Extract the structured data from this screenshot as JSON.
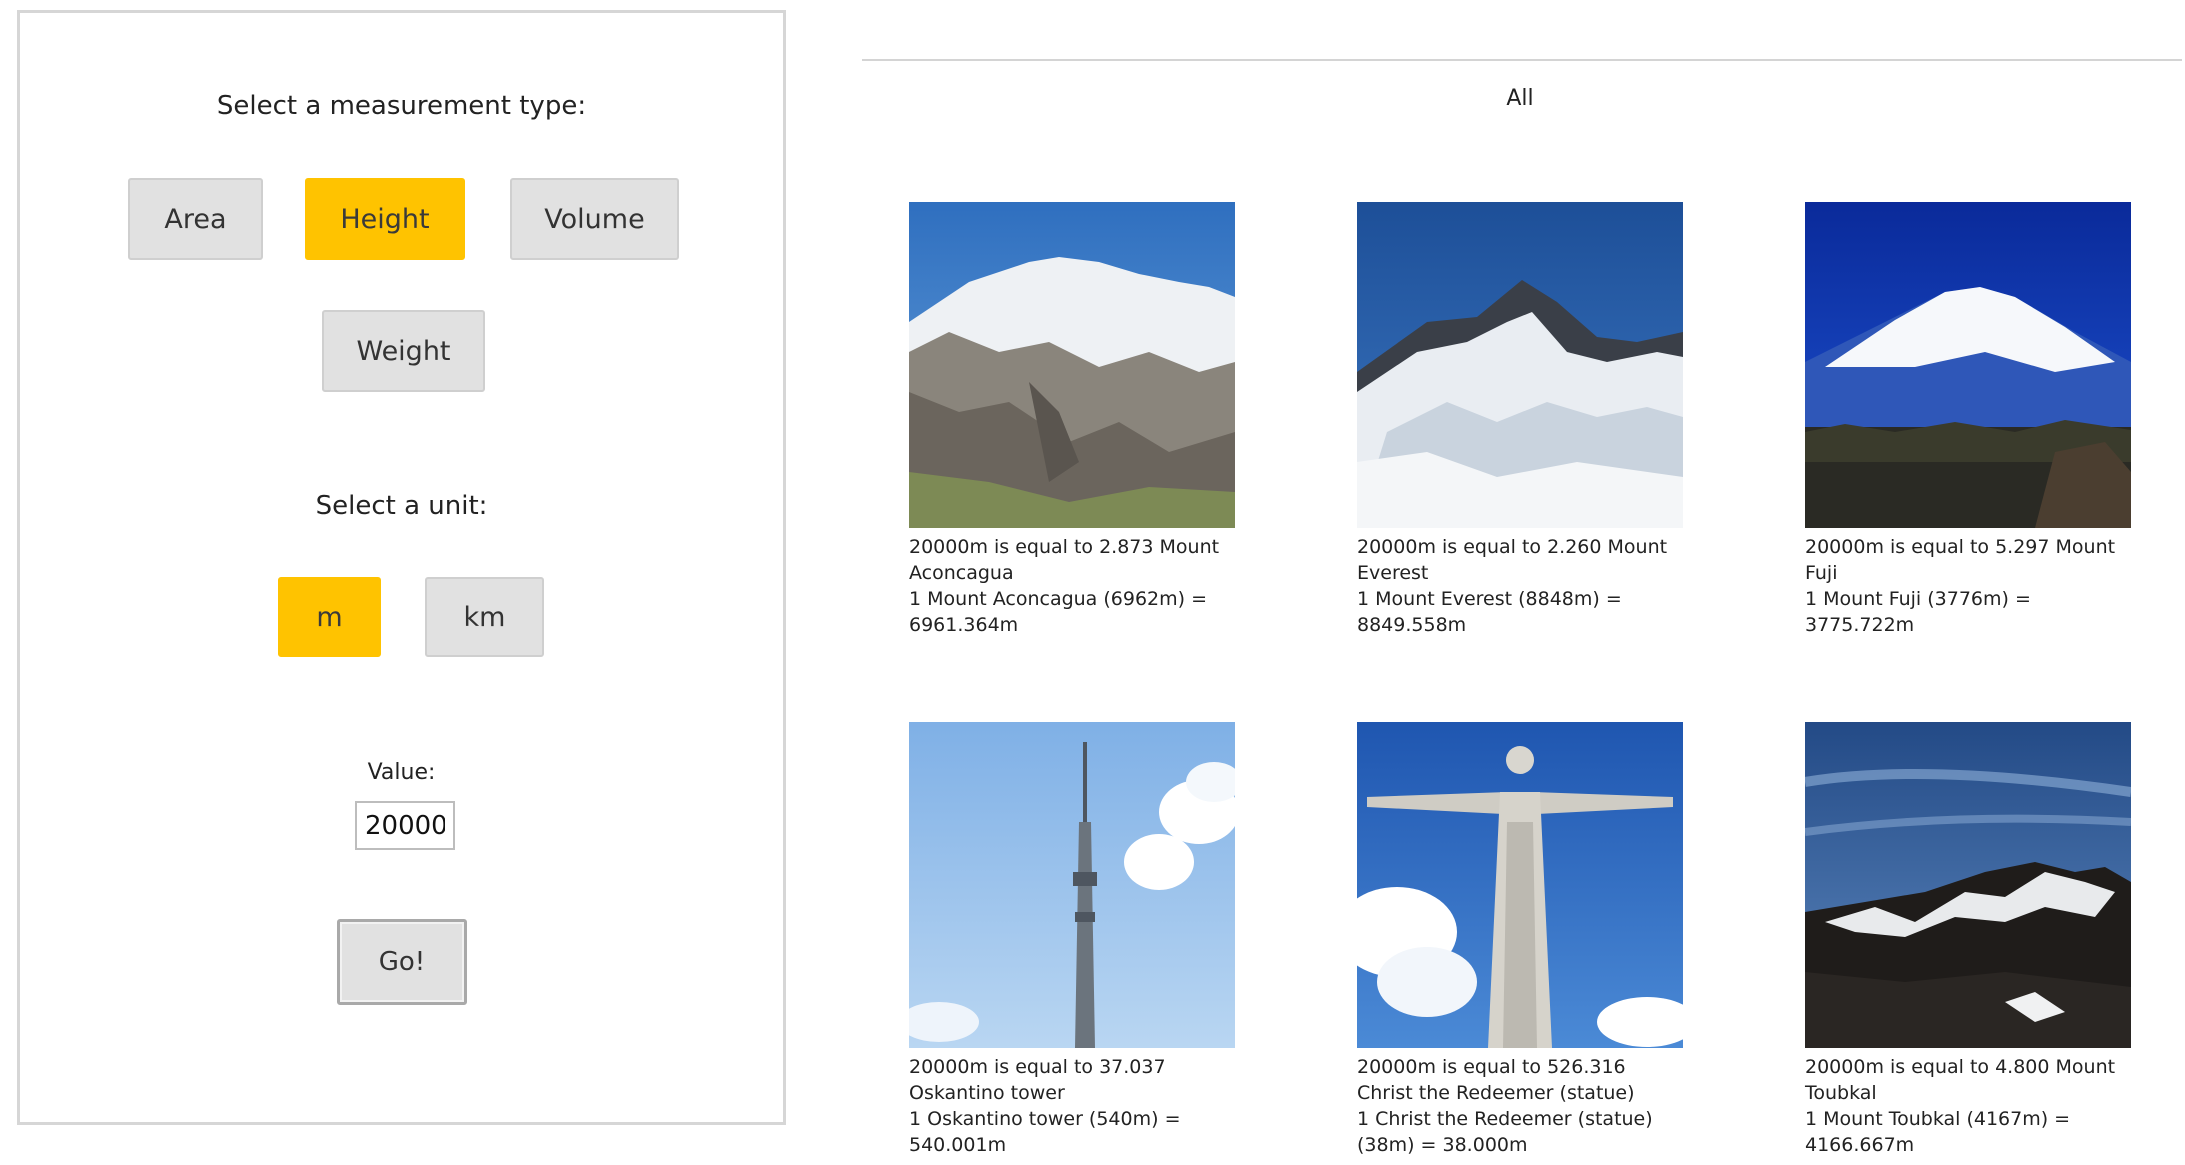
{
  "panel": {
    "measurement_title": "Select a measurement type:",
    "measurement_types": [
      "Area",
      "Height",
      "Volume",
      "Weight"
    ],
    "active_measurement": "Height",
    "unit_title": "Select a unit:",
    "units": [
      "m",
      "km"
    ],
    "active_unit": "m",
    "value_label": "Value:",
    "value": "20000",
    "go_label": "Go!"
  },
  "results": {
    "filter_label": "All",
    "items": [
      {
        "image": "mount-aconcagua-photo",
        "line1": "20000m is equal to 2.873 Mount Aconcagua",
        "line2": "1 Mount Aconcagua (6962m) = 6961.364m"
      },
      {
        "image": "mount-everest-photo",
        "line1": "20000m is equal to 2.260 Mount Everest",
        "line2": "1 Mount Everest (8848m) = 8849.558m"
      },
      {
        "image": "mount-fuji-photo",
        "line1": "20000m is equal to 5.297 Mount Fuji",
        "line2": "1 Mount Fuji (3776m) = 3775.722m"
      },
      {
        "image": "oskantino-tower-photo",
        "line1": "20000m is equal to 37.037 Oskantino tower",
        "line2": "1 Oskantino tower (540m) = 540.001m"
      },
      {
        "image": "christ-the-redeemer-photo",
        "line1": "20000m is equal to 526.316 Christ the Redeemer (statue)",
        "line2": "1 Christ the Redeemer (statue) (38m) = 38.000m"
      },
      {
        "image": "mount-toubkal-photo",
        "line1": "20000m is equal to 4.800 Mount Toubkal",
        "line2": "1 Mount Toubkal (4167m) = 4166.667m"
      }
    ]
  },
  "colors": {
    "active": "#ffc300",
    "inactive": "#e1e1e1",
    "border": "#d6d6d6"
  }
}
